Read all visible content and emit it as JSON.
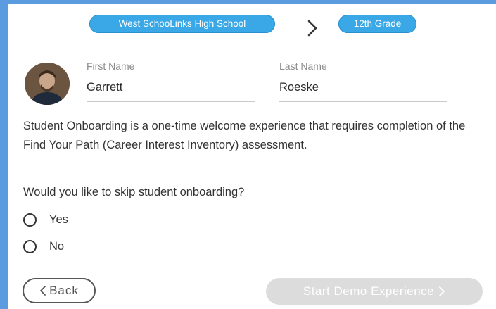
{
  "breadcrumb": {
    "school": "West SchooLinks High School",
    "grade": "12th Grade"
  },
  "profile": {
    "first_name_label": "First Name",
    "first_name_value": "Garrett",
    "last_name_label": "Last Name",
    "last_name_value": "Roeske"
  },
  "onboarding": {
    "description": "Student Onboarding is a one-time welcome experience that requires completion of the Find Your Path (Career Interest Inventory) assessment.",
    "question": "Would you like to skip student onboarding?",
    "options": [
      "Yes",
      "No"
    ]
  },
  "actions": {
    "back_label": "Back",
    "back_icon": "chevron-left-icon",
    "start_label": "Start Demo Experience",
    "start_icon": "chevron-right-icon"
  },
  "colors": {
    "pill": "#3aa8e6",
    "page_background": "#5b9be0",
    "disabled_button": "#dcdcdc"
  }
}
